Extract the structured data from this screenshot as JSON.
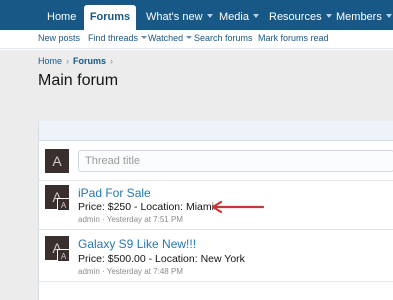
{
  "topnav": {
    "tabs": [
      {
        "label": "Home",
        "dropdown": false
      },
      {
        "label": "Forums",
        "dropdown": false,
        "active": true
      },
      {
        "label": "What's new",
        "dropdown": true
      },
      {
        "label": "Media",
        "dropdown": true
      },
      {
        "label": "Resources",
        "dropdown": true
      },
      {
        "label": "Members",
        "dropdown": true
      }
    ]
  },
  "subnav": {
    "links": [
      {
        "label": "New posts",
        "dropdown": false
      },
      {
        "label": "Find threads",
        "dropdown": true
      },
      {
        "label": "Watched",
        "dropdown": true
      },
      {
        "label": "Search forums",
        "dropdown": false
      },
      {
        "label": "Mark forums read",
        "dropdown": false
      }
    ]
  },
  "breadcrumb": [
    "Home",
    "Forums"
  ],
  "page": {
    "title": "Main forum"
  },
  "new_thread": {
    "placeholder": "Thread title",
    "avatar_letter": "A"
  },
  "threads": [
    {
      "title": "iPad For Sale",
      "description": "Price: $250 - Location: Miami",
      "meta": "admin · Yesterday at 7:51 PM",
      "avatar_letter": "A",
      "avatar_small_letter": "A",
      "highlighted": true
    },
    {
      "title": "Galaxy S9 Like New!!!",
      "description": "Price: $500.00 - Location: New York",
      "meta": "admin · Yesterday at 7:48 PM",
      "avatar_letter": "A",
      "avatar_small_letter": "A",
      "highlighted": false
    }
  ],
  "colors": {
    "nav_bg": "#185886",
    "link": "#2577b1",
    "arrow": "#cc3333",
    "avatar_bg": "#3a2f2f"
  },
  "icons": {
    "dropdown": "chevron-down-icon",
    "annotation": "arrow-left-icon"
  }
}
